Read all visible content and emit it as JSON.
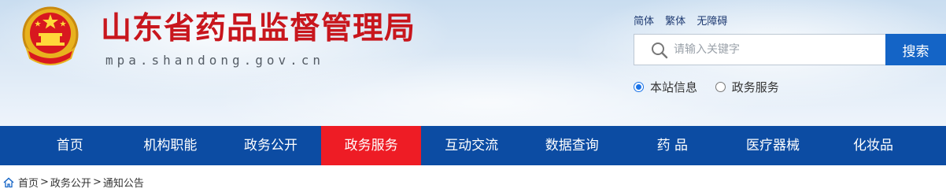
{
  "header": {
    "title": "山东省药品监督管理局",
    "domain": "mpa.shandong.gov.cn",
    "lang_links": [
      "简体",
      "繁体",
      "无障碍"
    ]
  },
  "search": {
    "placeholder": "请输入关键字",
    "button_label": "搜索",
    "scopes": [
      {
        "label": "本站信息",
        "checked": true
      },
      {
        "label": "政务服务",
        "checked": false
      }
    ]
  },
  "nav": {
    "items": [
      "首页",
      "机构职能",
      "政务公开",
      "政务服务",
      "互动交流",
      "数据查询",
      "药 品",
      "医疗器械",
      "化妆品"
    ],
    "active": "政务服务"
  },
  "breadcrumb": {
    "items": [
      "首页",
      "政务公开",
      "通知公告"
    ],
    "separator": ">"
  },
  "colors": {
    "title": "#c8161d",
    "nav_bg": "#0c4ca3",
    "nav_active": "#ee1c25",
    "search_button": "#1464c6"
  }
}
